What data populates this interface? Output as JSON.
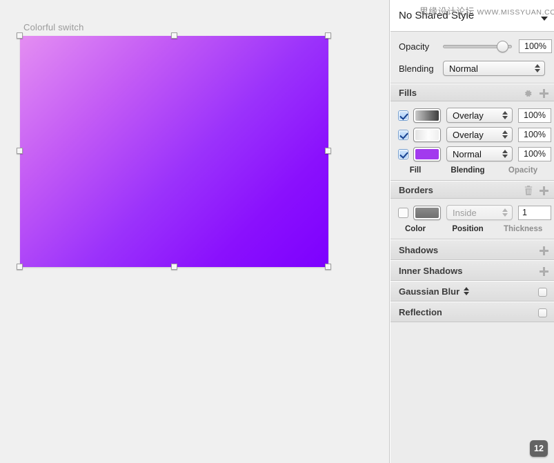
{
  "canvas": {
    "layer_label": "Colorful switch",
    "shape": {
      "gradient_start": "#e48ef2",
      "gradient_mid": "#9b32fb",
      "gradient_end": "#7d00ff"
    }
  },
  "watermark": {
    "cn": "思缘设计论坛",
    "url": "WWW.MISSYUAN.COM"
  },
  "inspector": {
    "shared_style": {
      "label": "No Shared Style",
      "caret_icon": "chevron-down-icon"
    },
    "opacity": {
      "label": "Opacity",
      "value": "100%",
      "slider_percent": 100
    },
    "blending": {
      "label": "Blending",
      "value": "Normal"
    },
    "fills": {
      "title": "Fills",
      "settings_icon": "gear-icon",
      "add_icon": "plus-icon",
      "columns": {
        "fill": "Fill",
        "blending": "Blending",
        "opacity": "Opacity"
      },
      "rows": [
        {
          "enabled": true,
          "swatch_type": "gradient",
          "swatch_from": "#c9c9c9",
          "swatch_to": "#3d3d3d",
          "blending": "Overlay",
          "opacity": "100%"
        },
        {
          "enabled": true,
          "swatch_type": "gradient",
          "swatch_from": "#eaeaea",
          "swatch_to": "#fbfbfb",
          "blending": "Overlay",
          "opacity": "100%"
        },
        {
          "enabled": true,
          "swatch_type": "solid",
          "swatch_from": "#a23aee",
          "swatch_to": "#a23aee",
          "blending": "Normal",
          "opacity": "100%"
        }
      ]
    },
    "borders": {
      "title": "Borders",
      "delete_icon": "trash-icon",
      "add_icon": "plus-icon",
      "columns": {
        "color": "Color",
        "position": "Position",
        "thickness": "Thickness"
      },
      "row": {
        "enabled": false,
        "swatch_color": "#7d7d7d",
        "position": "Inside",
        "thickness": "1"
      }
    },
    "shadows": {
      "title": "Shadows",
      "add_icon": "plus-icon"
    },
    "inner_shadows": {
      "title": "Inner Shadows",
      "add_icon": "plus-icon"
    },
    "gaussian_blur": {
      "title": "Gaussian Blur",
      "enabled": false,
      "stepper_icon": "stepper-icon"
    },
    "reflection": {
      "title": "Reflection",
      "enabled": false
    }
  },
  "zoom_badge": {
    "value": "12"
  }
}
